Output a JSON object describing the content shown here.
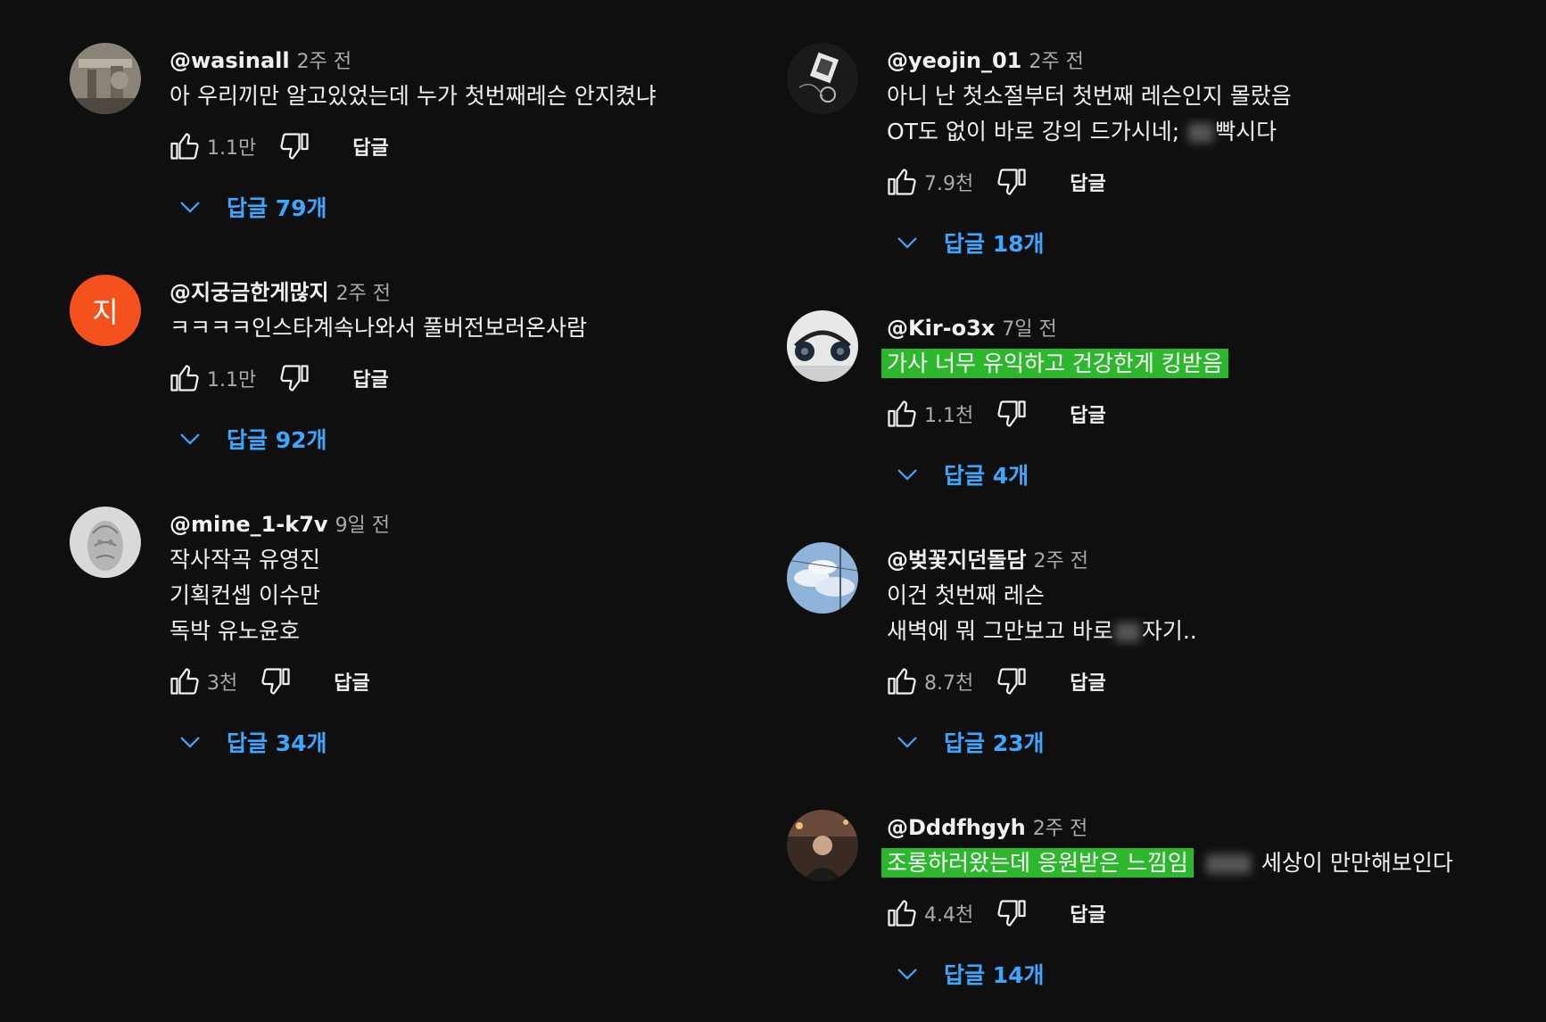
{
  "labels": {
    "reply": "답글"
  },
  "icons": {
    "like": "thumbs-up-icon",
    "dislike": "thumbs-down-icon",
    "expand": "chevron-down-icon"
  },
  "colors": {
    "background": "#0f0f0f",
    "link": "#3ea6ff",
    "highlight": "#2db72d",
    "avatar_letter_bg": "#f4511e"
  },
  "comments": [
    {
      "author": "@wasinall",
      "time": "2주 전",
      "lines": [
        "아 우리끼만 알고있었는데 누가 첫번째레슨 안지켰냐"
      ],
      "likes": "1.1만",
      "replies": "답글 79개"
    },
    {
      "author": "@지궁금한게많지",
      "avatar_letter": "지",
      "time": "2주 전",
      "lines": [
        "ㅋㅋㅋㅋ인스타계속나와서 풀버전보러온사람"
      ],
      "likes": "1.1만",
      "replies": "답글 92개"
    },
    {
      "author": "@mine_1-k7v",
      "time": "9일 전",
      "lines": [
        "작사작곡 유영진",
        "기획컨셉 이수만",
        "독박 유노윤호"
      ],
      "likes": "3천",
      "replies": "답글 34개"
    },
    {
      "author": "@yeojin_01",
      "time": "2주 전",
      "lines": [
        "아니 난 첫소절부터 첫번째 레슨인지 몰랐음",
        "OT도 없이 바로 강의 드가시네;",
        "빡시다"
      ],
      "likes": "7.9천",
      "replies": "답글 18개"
    },
    {
      "author": "@Kir-o3x",
      "time": "7일 전",
      "lines": [
        "가사 너무 유익하고 건강한게 킹받음"
      ],
      "likes": "1.1천",
      "replies": "답글 4개"
    },
    {
      "author": "@벚꽃지던돌담",
      "time": "2주 전",
      "lines": [
        "이건 첫번째 레슨",
        "새벽에 뭐 그만보고 바로",
        "자기.."
      ],
      "likes": "8.7천",
      "replies": "답글 23개"
    },
    {
      "author": "@Dddfhgyh",
      "time": "2주 전",
      "lines": [
        "조롱하러왔는데 응원받은 느낌임",
        "세상이 만만해보인다"
      ],
      "likes": "4.4천",
      "replies": "답글 14개"
    }
  ]
}
